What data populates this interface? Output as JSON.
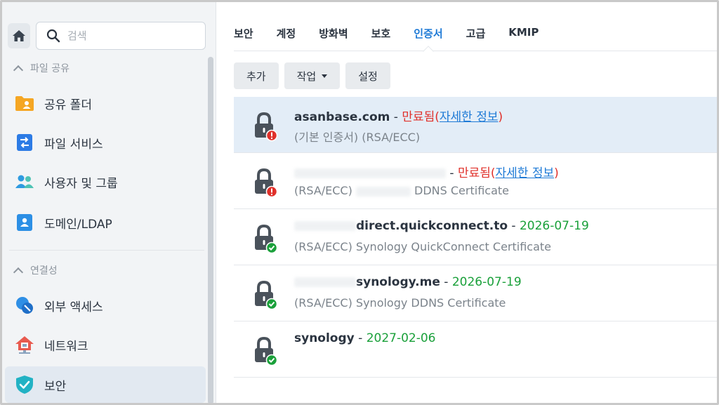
{
  "sidebar": {
    "search_placeholder": "검색",
    "sections": [
      {
        "label": "파일 공유",
        "items": [
          {
            "label": "공유 폴더",
            "icon": "shared-folder-icon"
          },
          {
            "label": "파일 서비스",
            "icon": "file-services-icon"
          },
          {
            "label": "사용자 및 그룹",
            "icon": "users-groups-icon"
          },
          {
            "label": "도메인/LDAP",
            "icon": "domain-ldap-icon"
          }
        ]
      },
      {
        "label": "연결성",
        "items": [
          {
            "label": "외부 액세스",
            "icon": "external-access-icon"
          },
          {
            "label": "네트워크",
            "icon": "network-icon"
          },
          {
            "label": "보안",
            "icon": "security-shield-icon",
            "active": true
          }
        ]
      }
    ]
  },
  "tabs": [
    {
      "label": "보안"
    },
    {
      "label": "계정"
    },
    {
      "label": "방화벽"
    },
    {
      "label": "보호"
    },
    {
      "label": "인증서",
      "active": true
    },
    {
      "label": "고급"
    },
    {
      "label": "KMIP"
    }
  ],
  "toolbar": {
    "add_label": "추가",
    "action_label": "작업",
    "settings_label": "설정"
  },
  "certificates": [
    {
      "name": "asanbase.com",
      "status": "만료됨",
      "details_link": "자세한 정보",
      "subtitle": "(기본 인증서) (RSA/ECC)",
      "state": "expired",
      "selected": true
    },
    {
      "name": "",
      "status": "만료됨",
      "details_link": "자세한 정보",
      "subtitle_prefix": "(RSA/ECC)",
      "subtitle": "DDNS Certificate",
      "state": "expired"
    },
    {
      "name": "direct.quickconnect.to",
      "date": "2026-07-19",
      "subtitle": "(RSA/ECC) Synology QuickConnect Certificate",
      "state": "valid"
    },
    {
      "name": "synology.me",
      "date": "2026-07-19",
      "subtitle": "(RSA/ECC) Synology DDNS Certificate",
      "state": "valid"
    },
    {
      "name": "synology",
      "date": "2027-02-06",
      "subtitle": "",
      "state": "valid"
    }
  ],
  "colors": {
    "accent": "#1e7ad6",
    "expired": "#e0302a",
    "valid": "#1aa03a",
    "selected_row": "#e3edf7"
  }
}
